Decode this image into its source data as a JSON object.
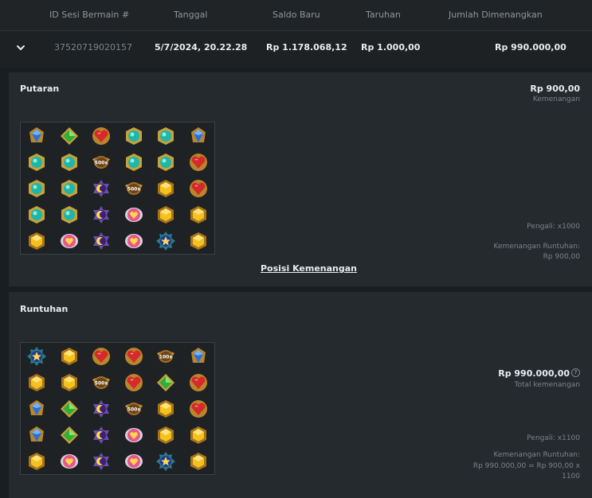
{
  "header": {
    "col_id": "ID Sesi Bermain #",
    "col_date": "Tanggal",
    "col_balance": "Saldo Baru",
    "col_bet": "Taruhan",
    "col_won": "Jumlah Dimenangkan"
  },
  "row": {
    "id": "37520719020157",
    "date": "5/7/2024, 20.22.28",
    "balance": "Rp 1.178.068,12",
    "bet": "Rp 1.000,00",
    "won": "Rp 990.000,00"
  },
  "panel1": {
    "title": "Putaran",
    "amount": "Rp 900,00",
    "amount_label": "Kemenangan",
    "multiplier": "Pengali: x1000",
    "tumble_label": "Kemenangan Runtuhan:",
    "tumble_value": "Rp 900,00",
    "link": "Posisi Kemenangan",
    "grid": [
      [
        "blue",
        "green",
        "red",
        "teal",
        "teal",
        "blue"
      ],
      [
        "teal",
        "teal",
        "mult:500x",
        "teal",
        "teal",
        "red"
      ],
      [
        "teal",
        "teal",
        "purple",
        "mult:500x",
        "yellow",
        "red"
      ],
      [
        "teal",
        "teal",
        "purple",
        "pink",
        "yellow",
        "yellow"
      ],
      [
        "yellow",
        "pink",
        "purple",
        "pink",
        "star",
        "yellow"
      ]
    ]
  },
  "panel2": {
    "title": "Runtuhan",
    "amount": "Rp 990.000,00",
    "amount_label": "Total kemenangan",
    "help": "?",
    "multiplier": "Pengali: x1100",
    "tumble_label": "Kemenangan Runtuhan:",
    "tumble_value": "Rp 990.000,00 = Rp 900,00 x 1100",
    "grid": [
      [
        "star",
        "yellow",
        "red",
        "red",
        "mult:100x",
        "blue"
      ],
      [
        "yellow",
        "yellow",
        "mult:500x",
        "red",
        "green",
        "red"
      ],
      [
        "blue",
        "green",
        "purple",
        "mult:500x",
        "yellow",
        "red"
      ],
      [
        "blue",
        "green",
        "purple",
        "pink",
        "yellow",
        "yellow"
      ],
      [
        "yellow",
        "pink",
        "purple",
        "pink",
        "star",
        "yellow"
      ]
    ]
  },
  "icons": {
    "blue": "blue-gem-icon",
    "green": "green-gem-icon",
    "red": "red-heart-gem-icon",
    "teal": "teal-gem-icon",
    "yellow": "yellow-hexagon-gem-icon",
    "pink": "pink-heart-icon",
    "purple": "purple-moon-icon",
    "star": "star-emblem-icon",
    "mult": "multiplier-orb-icon"
  },
  "colors": {
    "background": "#1b1e21",
    "panel": "#252a2e",
    "header": "#202427",
    "text_muted": "#8e969c"
  }
}
